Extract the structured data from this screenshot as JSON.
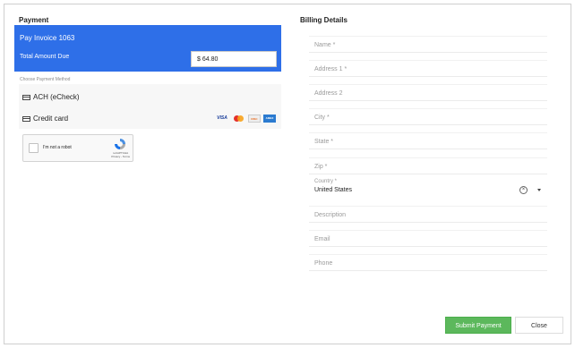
{
  "payment": {
    "title": "Payment",
    "invoice_label": "Pay Invoice 1063",
    "total_label": "Total Amount Due",
    "amount_value": "$ 64.80",
    "choose_method_label": "Choose Payment Method",
    "methods": [
      {
        "label": "ACH (eCheck)"
      },
      {
        "label": "Credit card"
      }
    ],
    "card_brands": [
      "visa",
      "mastercard",
      "discover",
      "amex"
    ],
    "card_visa_text": "VISA",
    "accent_color": "#2e6fe8"
  },
  "captcha": {
    "label": "I'm not a robot",
    "brand": "reCAPTCHA",
    "links": "Privacy - Terms"
  },
  "billing": {
    "title": "Billing Details",
    "name_placeholder": "Name *",
    "address1_placeholder": "Address 1 *",
    "address2_placeholder": "Address 2",
    "city_placeholder": "City *",
    "state_placeholder": "State *",
    "zip_placeholder": "Zip *",
    "country_label": "Country *",
    "country_value": "United States",
    "description_placeholder": "Description",
    "email_placeholder": "Email",
    "phone_placeholder": "Phone"
  },
  "actions": {
    "submit_label": "Submit Payment",
    "close_label": "Close",
    "submit_color": "#5cb85c"
  }
}
